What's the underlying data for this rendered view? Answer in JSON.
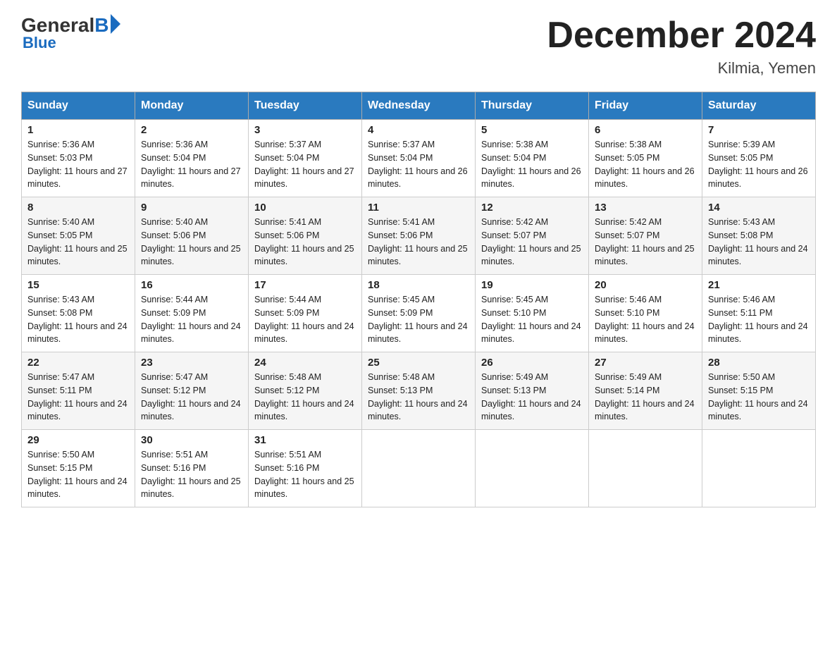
{
  "header": {
    "logo": {
      "general": "General",
      "blue": "Blue",
      "arrow": "▶"
    },
    "title": "December 2024",
    "location": "Kilmia, Yemen"
  },
  "days_of_week": [
    "Sunday",
    "Monday",
    "Tuesday",
    "Wednesday",
    "Thursday",
    "Friday",
    "Saturday"
  ],
  "weeks": [
    [
      {
        "day": "1",
        "sunrise": "5:36 AM",
        "sunset": "5:03 PM",
        "daylight": "11 hours and 27 minutes."
      },
      {
        "day": "2",
        "sunrise": "5:36 AM",
        "sunset": "5:04 PM",
        "daylight": "11 hours and 27 minutes."
      },
      {
        "day": "3",
        "sunrise": "5:37 AM",
        "sunset": "5:04 PM",
        "daylight": "11 hours and 27 minutes."
      },
      {
        "day": "4",
        "sunrise": "5:37 AM",
        "sunset": "5:04 PM",
        "daylight": "11 hours and 26 minutes."
      },
      {
        "day": "5",
        "sunrise": "5:38 AM",
        "sunset": "5:04 PM",
        "daylight": "11 hours and 26 minutes."
      },
      {
        "day": "6",
        "sunrise": "5:38 AM",
        "sunset": "5:05 PM",
        "daylight": "11 hours and 26 minutes."
      },
      {
        "day": "7",
        "sunrise": "5:39 AM",
        "sunset": "5:05 PM",
        "daylight": "11 hours and 26 minutes."
      }
    ],
    [
      {
        "day": "8",
        "sunrise": "5:40 AM",
        "sunset": "5:05 PM",
        "daylight": "11 hours and 25 minutes."
      },
      {
        "day": "9",
        "sunrise": "5:40 AM",
        "sunset": "5:06 PM",
        "daylight": "11 hours and 25 minutes."
      },
      {
        "day": "10",
        "sunrise": "5:41 AM",
        "sunset": "5:06 PM",
        "daylight": "11 hours and 25 minutes."
      },
      {
        "day": "11",
        "sunrise": "5:41 AM",
        "sunset": "5:06 PM",
        "daylight": "11 hours and 25 minutes."
      },
      {
        "day": "12",
        "sunrise": "5:42 AM",
        "sunset": "5:07 PM",
        "daylight": "11 hours and 25 minutes."
      },
      {
        "day": "13",
        "sunrise": "5:42 AM",
        "sunset": "5:07 PM",
        "daylight": "11 hours and 25 minutes."
      },
      {
        "day": "14",
        "sunrise": "5:43 AM",
        "sunset": "5:08 PM",
        "daylight": "11 hours and 24 minutes."
      }
    ],
    [
      {
        "day": "15",
        "sunrise": "5:43 AM",
        "sunset": "5:08 PM",
        "daylight": "11 hours and 24 minutes."
      },
      {
        "day": "16",
        "sunrise": "5:44 AM",
        "sunset": "5:09 PM",
        "daylight": "11 hours and 24 minutes."
      },
      {
        "day": "17",
        "sunrise": "5:44 AM",
        "sunset": "5:09 PM",
        "daylight": "11 hours and 24 minutes."
      },
      {
        "day": "18",
        "sunrise": "5:45 AM",
        "sunset": "5:09 PM",
        "daylight": "11 hours and 24 minutes."
      },
      {
        "day": "19",
        "sunrise": "5:45 AM",
        "sunset": "5:10 PM",
        "daylight": "11 hours and 24 minutes."
      },
      {
        "day": "20",
        "sunrise": "5:46 AM",
        "sunset": "5:10 PM",
        "daylight": "11 hours and 24 minutes."
      },
      {
        "day": "21",
        "sunrise": "5:46 AM",
        "sunset": "5:11 PM",
        "daylight": "11 hours and 24 minutes."
      }
    ],
    [
      {
        "day": "22",
        "sunrise": "5:47 AM",
        "sunset": "5:11 PM",
        "daylight": "11 hours and 24 minutes."
      },
      {
        "day": "23",
        "sunrise": "5:47 AM",
        "sunset": "5:12 PM",
        "daylight": "11 hours and 24 minutes."
      },
      {
        "day": "24",
        "sunrise": "5:48 AM",
        "sunset": "5:12 PM",
        "daylight": "11 hours and 24 minutes."
      },
      {
        "day": "25",
        "sunrise": "5:48 AM",
        "sunset": "5:13 PM",
        "daylight": "11 hours and 24 minutes."
      },
      {
        "day": "26",
        "sunrise": "5:49 AM",
        "sunset": "5:13 PM",
        "daylight": "11 hours and 24 minutes."
      },
      {
        "day": "27",
        "sunrise": "5:49 AM",
        "sunset": "5:14 PM",
        "daylight": "11 hours and 24 minutes."
      },
      {
        "day": "28",
        "sunrise": "5:50 AM",
        "sunset": "5:15 PM",
        "daylight": "11 hours and 24 minutes."
      }
    ],
    [
      {
        "day": "29",
        "sunrise": "5:50 AM",
        "sunset": "5:15 PM",
        "daylight": "11 hours and 24 minutes."
      },
      {
        "day": "30",
        "sunrise": "5:51 AM",
        "sunset": "5:16 PM",
        "daylight": "11 hours and 25 minutes."
      },
      {
        "day": "31",
        "sunrise": "5:51 AM",
        "sunset": "5:16 PM",
        "daylight": "11 hours and 25 minutes."
      },
      null,
      null,
      null,
      null
    ]
  ]
}
